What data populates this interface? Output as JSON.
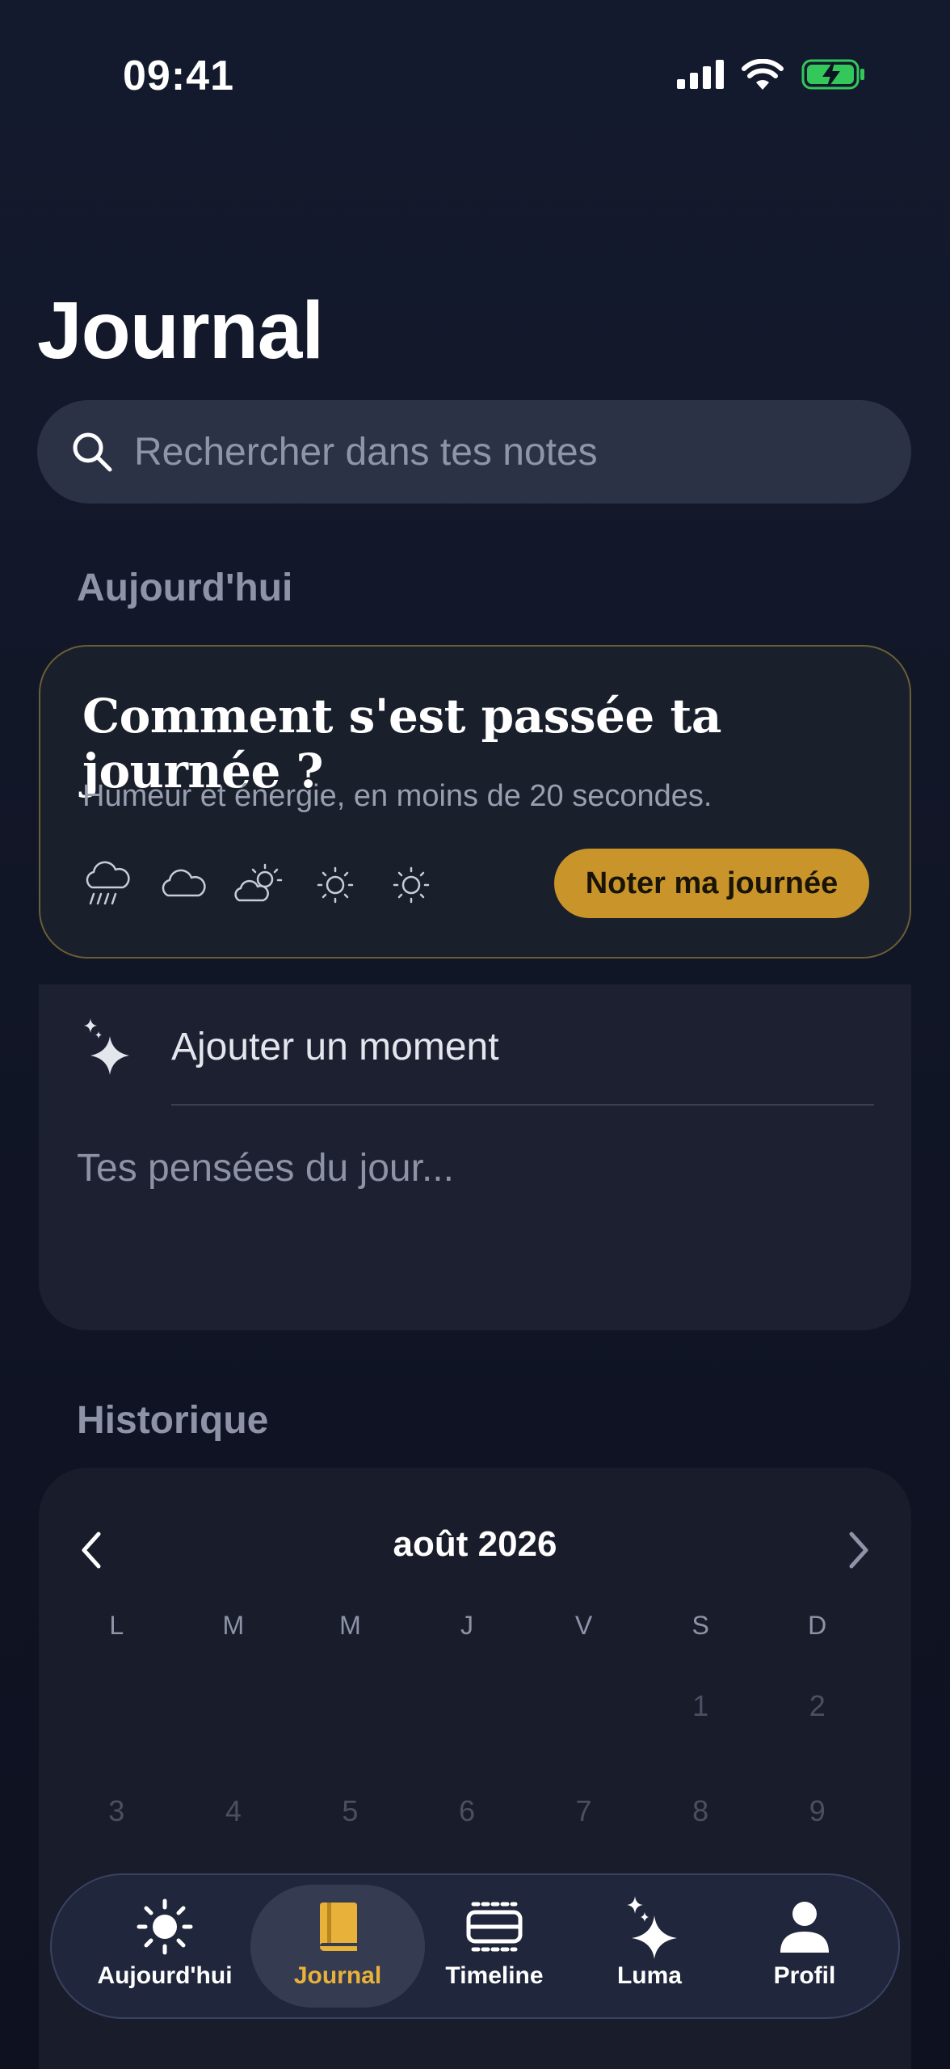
{
  "status_bar": {
    "time": "09:41"
  },
  "header": {
    "title": "Journal"
  },
  "search": {
    "placeholder": "Rechercher dans tes notes"
  },
  "today": {
    "section_label": "Aujourd'hui",
    "mood_card": {
      "title": "Comment s'est passée ta journée ?",
      "subtitle": "Humeur et énergie, en moins de 20 secondes.",
      "mood_icons": [
        "rain-cloud-icon",
        "cloud-icon",
        "partly-sunny-icon",
        "sun-icon",
        "sun-icon"
      ],
      "button_label": "Noter ma journée"
    },
    "notes": {
      "add_moment_label": "Ajouter un moment",
      "placeholder": "Tes pensées du jour..."
    }
  },
  "history": {
    "section_label": "Historique",
    "calendar": {
      "month": "août 2026",
      "weekdays": [
        "L",
        "M",
        "M",
        "J",
        "V",
        "S",
        "D"
      ],
      "days_row1": [
        "",
        "",
        "",
        "",
        "",
        "1",
        "2"
      ],
      "days_row2": [
        "3",
        "4",
        "5",
        "6",
        "7",
        "8",
        "9"
      ]
    }
  },
  "tabbar": {
    "items": [
      {
        "label": "Aujourd'hui",
        "icon": "sun-icon"
      },
      {
        "label": "Journal",
        "icon": "book-icon",
        "active": true
      },
      {
        "label": "Timeline",
        "icon": "timeline-icon"
      },
      {
        "label": "Luma",
        "icon": "sparkle-icon"
      },
      {
        "label": "Profil",
        "icon": "person-icon"
      }
    ]
  },
  "colors": {
    "accent": "#c9952a",
    "active_tab": "#e8b23a",
    "background": "#121728"
  }
}
